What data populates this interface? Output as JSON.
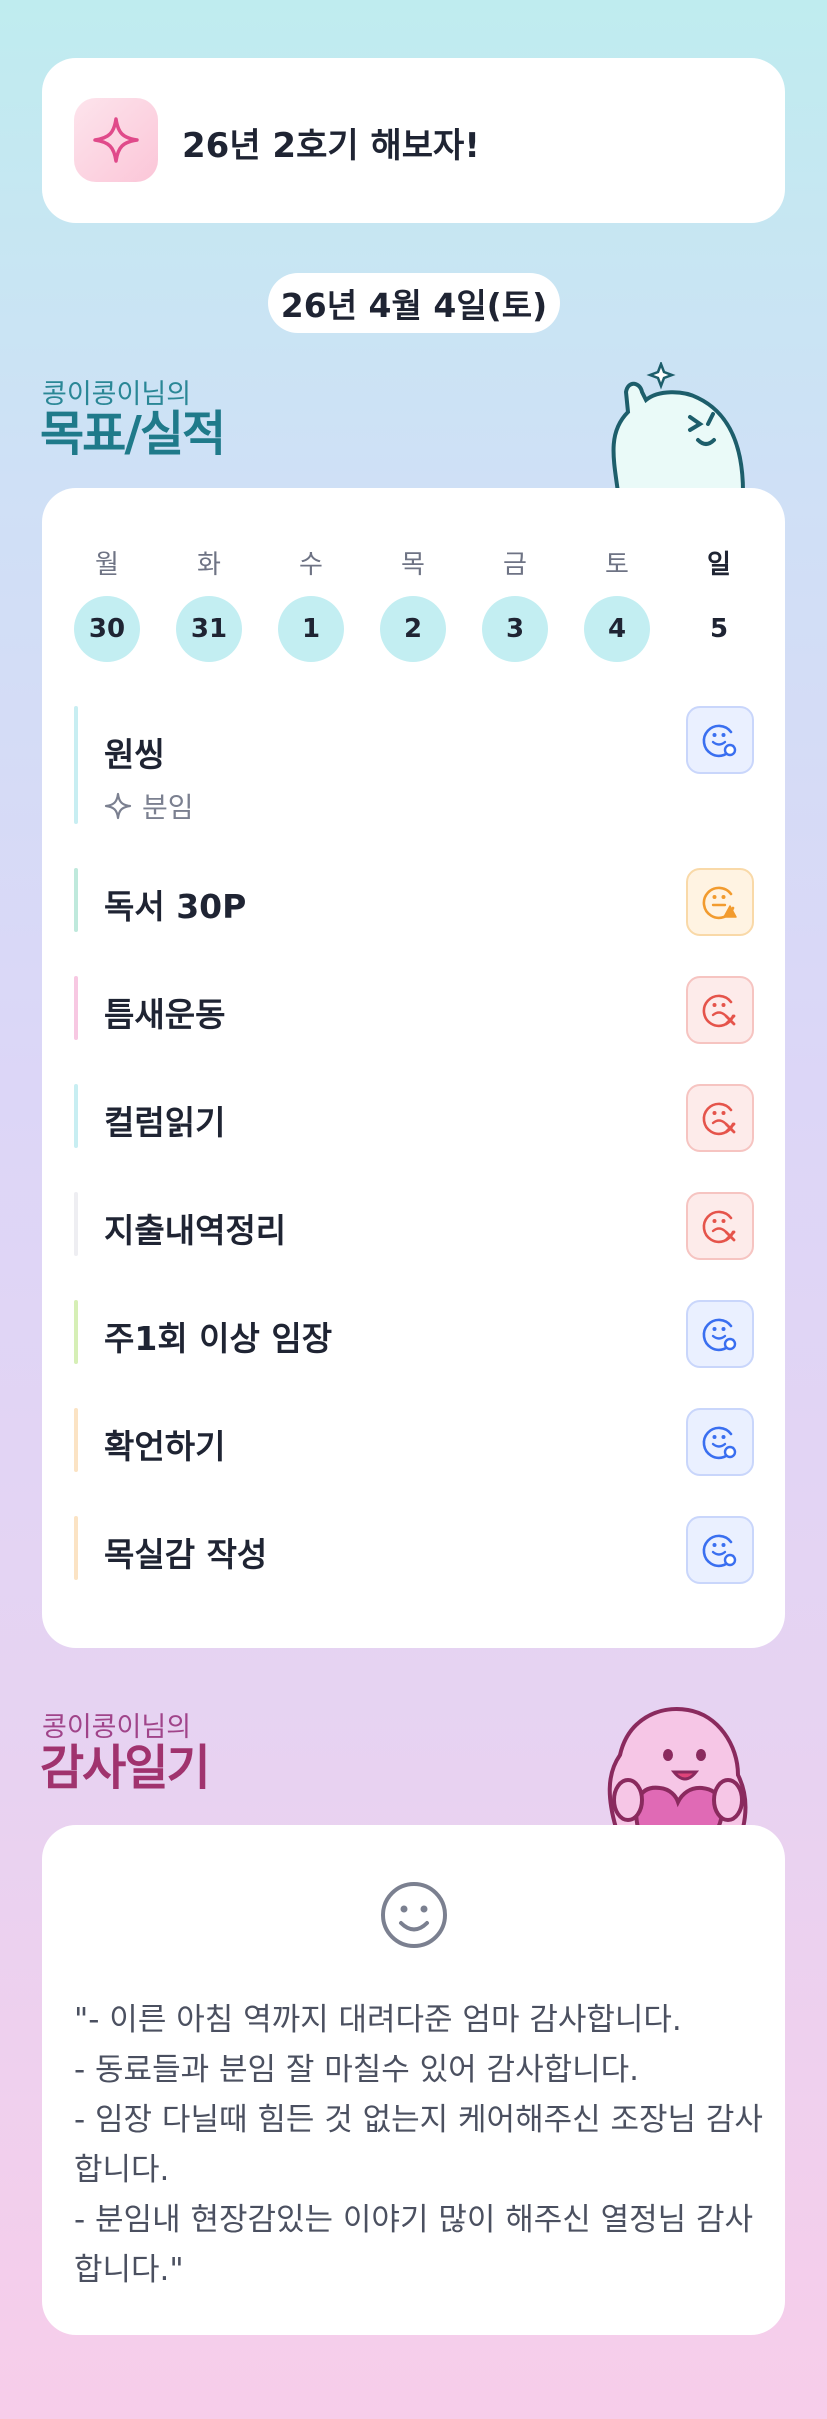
{
  "header": {
    "title": "26년 2호기 해보자!",
    "icon": "sparkle-icon"
  },
  "date_label": "26년 4월 4일(토)",
  "goal_section": {
    "owner": "콩이콩이님의",
    "title": "목표/실적"
  },
  "calendar": {
    "weekdays": [
      "월",
      "화",
      "수",
      "목",
      "금",
      "토",
      "일"
    ],
    "dates": [
      "30",
      "31",
      "1",
      "2",
      "3",
      "4",
      "5"
    ]
  },
  "goals": [
    {
      "name": "원씽",
      "sub": "분임",
      "status": "done",
      "bar_color": "#c8eef2"
    },
    {
      "name": "독서 30P",
      "status": "partial",
      "bar_color": "#bfe9dc"
    },
    {
      "name": "틈새운동",
      "status": "fail",
      "bar_color": "#f7c8e2"
    },
    {
      "name": "컬럼읽기",
      "status": "fail",
      "bar_color": "#c8eef2"
    },
    {
      "name": "지출내역정리",
      "status": "fail",
      "bar_color": "#eeeef2"
    },
    {
      "name": "주1회 이상 임장",
      "status": "done",
      "bar_color": "#d6efb6"
    },
    {
      "name": "확언하기",
      "status": "done",
      "bar_color": "#fbe3c4"
    },
    {
      "name": "목실감 작성",
      "status": "done",
      "bar_color": "#fbe3c4"
    }
  ],
  "thanks_section": {
    "owner": "콩이콩이님의",
    "title": "감사일기"
  },
  "diary": {
    "mood_icon": "smile-face-icon",
    "text": "\"- 이른 아침 역까지 대려다준 엄마 감사합니다.\n- 동료들과 분임 잘 마칠수 있어 감사합니다.\n- 임장 다닐때 힘든 것 없는지 케어해주신 조장님 감사합니다.\n- 분임내 현장감있는 이야기 많이 해주신 열정님 감사합니다.\""
  },
  "colors": {
    "accent_teal": "#1f7a8a",
    "accent_pink": "#a0336e",
    "ok": "#3a6ff0",
    "warn": "#f29b2e",
    "fail": "#e5544b"
  }
}
